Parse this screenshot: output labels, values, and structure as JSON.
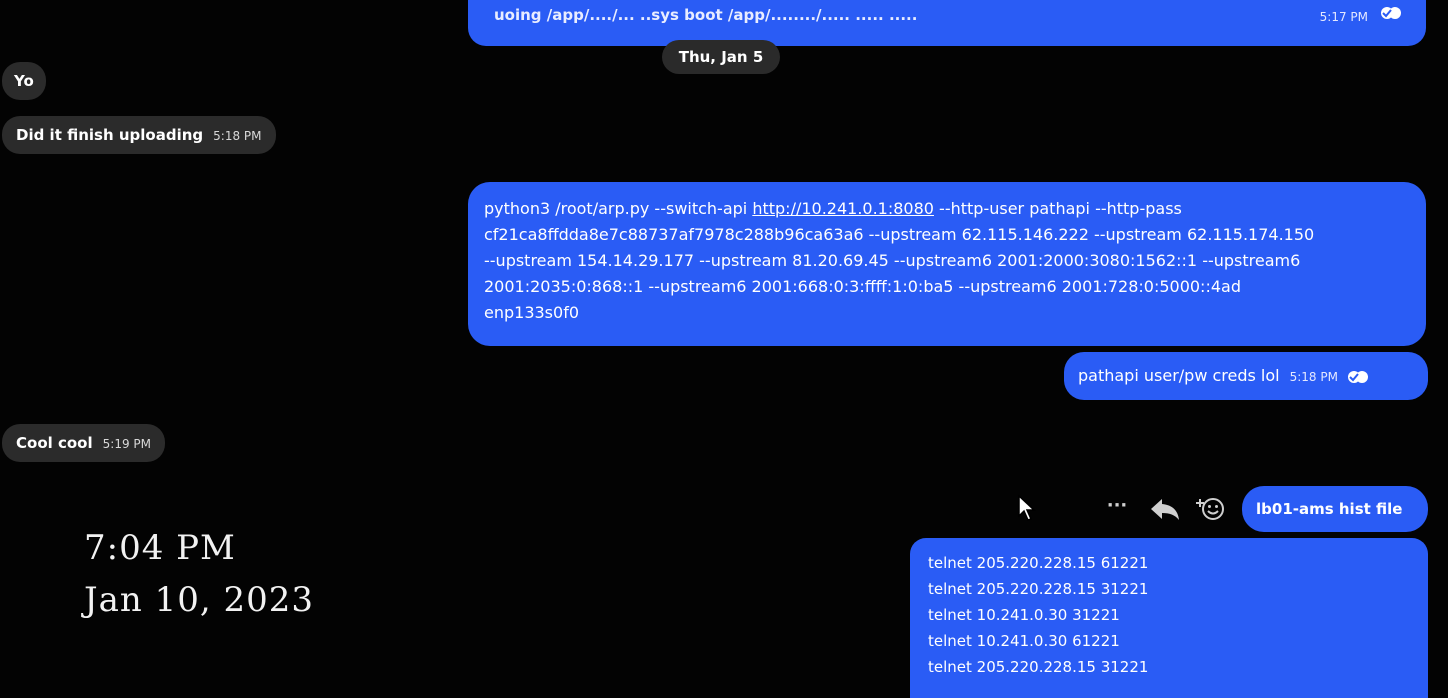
{
  "date_separator": "Thu, Jan 5",
  "top_partial_message": {
    "text": "uoing /app/..../...   ..sys  boot /app/......../..... .....  .....",
    "time": "5:17 PM"
  },
  "incoming": [
    {
      "text": "Yo",
      "time": ""
    },
    {
      "text": "Did it finish uploading",
      "time": "5:18 PM"
    },
    {
      "text": "Cool cool",
      "time": "5:19 PM"
    }
  ],
  "command_message": {
    "line1_prefix": "python3 /root/arp.py --switch-api ",
    "line1_link": "http://10.241.0.1:8080",
    "line1_suffix": " --http-user pathapi --http-pass",
    "line2": "cf21ca8ffdda8e7c88737af7978c288b96ca63a6 --upstream 62.115.146.222 --upstream 62.115.174.150",
    "line3": "--upstream 154.14.29.177 --upstream 81.20.69.45 --upstream6 2001:2000:3080:1562::1 --upstream6",
    "line4": "2001:2035:0:868::1 --upstream6 2001:668:0:3:ffff:1:0:ba5 --upstream6 2001:728:0:5000::4ad",
    "line5": "enp133s0f0"
  },
  "creds_message": {
    "text": "pathapi user/pw creds lol",
    "time": "5:18 PM"
  },
  "hist_file_message": {
    "text": "lb01-ams hist file"
  },
  "telnet_message": {
    "lines": [
      "telnet 205.220.228.15 61221",
      "telnet 205.220.228.15 31221",
      "telnet 10.241.0.30 31221",
      "telnet 10.241.0.30 61221",
      "telnet 205.220.228.15 31221"
    ]
  },
  "overlay": {
    "time": "7:04 PM",
    "date": "Jan 10, 2023"
  },
  "icons": {
    "more": "more-icon",
    "reply": "reply-icon",
    "react": "add-reaction-icon",
    "cursor": "mouse-cursor-icon",
    "read": "read-receipt-icon"
  },
  "colors": {
    "outgoing_bubble": "#2a5cf5",
    "incoming_bubble": "#2b2b2b",
    "background": "#030303"
  }
}
